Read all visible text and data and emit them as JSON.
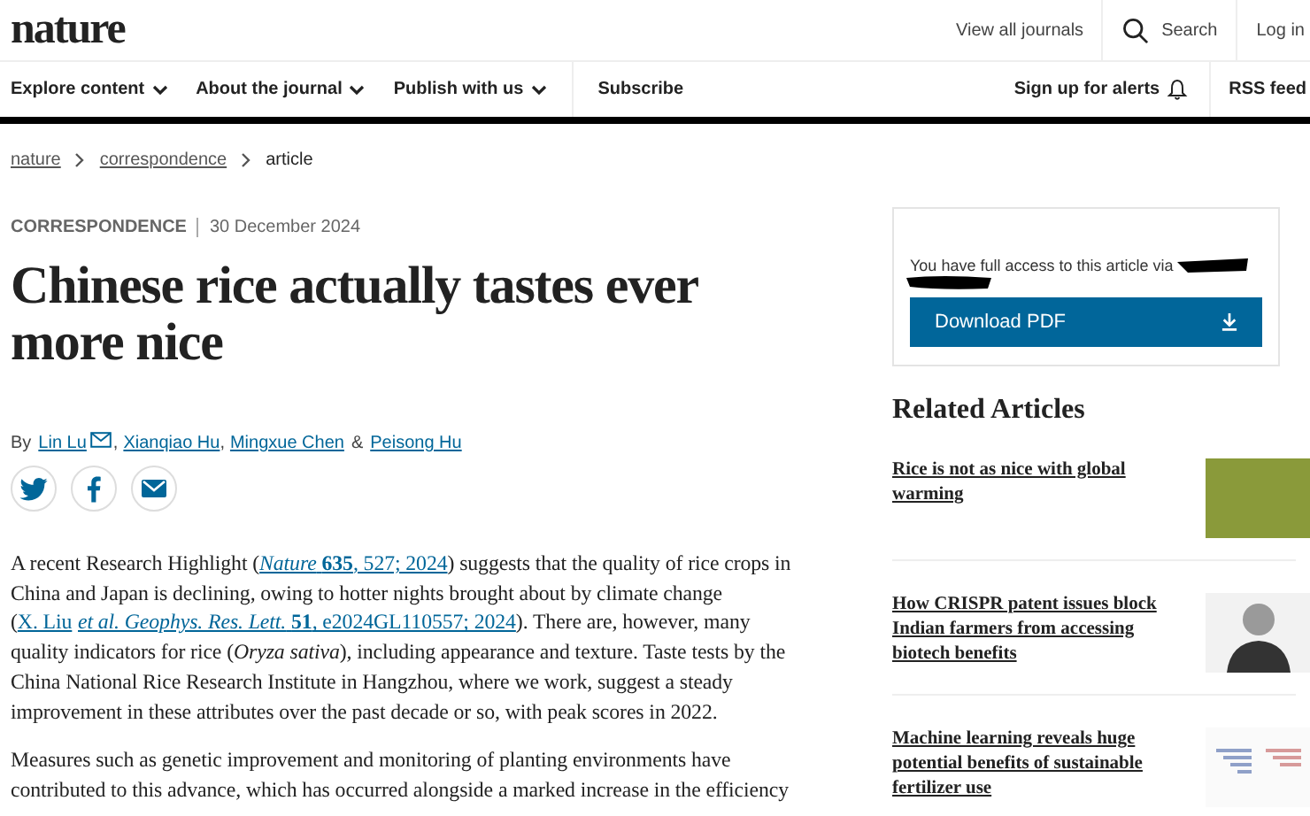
{
  "header": {
    "logo": "nature",
    "links": [
      {
        "label": "View all journals",
        "kind": "text"
      },
      {
        "label": "Search",
        "kind": "search"
      },
      {
        "label": "Log in",
        "kind": "text"
      }
    ]
  },
  "nav": {
    "left": [
      {
        "label": "Explore content",
        "kind": "dropdown"
      },
      {
        "label": "About the journal",
        "kind": "dropdown"
      },
      {
        "label": "Publish with us",
        "kind": "dropdown"
      },
      {
        "label": "Subscribe",
        "kind": "plain"
      }
    ],
    "right": [
      {
        "label": "Sign up for alerts",
        "kind": "bell"
      },
      {
        "label": "RSS feed",
        "kind": "plain"
      }
    ]
  },
  "breadcrumb": [
    {
      "label": "nature",
      "link": true
    },
    {
      "label": "correspondence",
      "link": true
    },
    {
      "label": "article",
      "link": false
    }
  ],
  "article": {
    "type": "CORRESPONDENCE",
    "date": "30 December 2024",
    "title": "Chinese rice actually tastes ever more nice",
    "by": "By",
    "authors": [
      {
        "name": "Lin Lu",
        "email": true,
        "sep": ","
      },
      {
        "name": "Xianqiao Hu",
        "email": false,
        "sep": ","
      },
      {
        "name": "Mingxue Chen",
        "email": false,
        "sep": "&"
      },
      {
        "name": "Peisong Hu",
        "email": false
      }
    ],
    "share": [
      {
        "kind": "twitter"
      },
      {
        "kind": "facebook"
      },
      {
        "kind": "email"
      }
    ],
    "paragraphs": [
      [
        {
          "kind": "text",
          "text": "A recent Research Highlight ("
        },
        {
          "kind": "link",
          "text": "*Nature* **635**, 527; 2024"
        },
        {
          "kind": "text",
          "text": ") suggests that the quality of rice crops in China and Japan is declining, owing to hotter nights brought about by climate change ("
        },
        {
          "kind": "link",
          "text": "X. Liu"
        },
        {
          "kind": "link",
          "text": "*et al. Geophys. Res. Lett.* **51**, e2024GL110557; 2024"
        },
        {
          "kind": "text",
          "text": "). There are, however, many quality indicators for rice (*Oryza sativa*), including appearance and texture. Taste tests by the China National Rice Research Institute in Hangzhou, where we work, suggest a steady improvement in these attributes over the past decade or so, with peak scores in 2022."
        }
      ],
      [
        {
          "kind": "text",
          "text": "Measures such as genetic improvement and monitoring of planting environments have contributed to this advance, which has occurred alongside a marked increase in the efficiency"
        }
      ]
    ]
  },
  "access": {
    "text": "You have full access to this article via",
    "redacted": true,
    "button": "Download PDF"
  },
  "related": {
    "heading": "Related Articles",
    "items": [
      {
        "title": "Rice is not as nice with global warming",
        "kind": "photo"
      },
      {
        "title": "How CRISPR patent issues block Indian farmers from accessing biotech benefits",
        "kind": "portrait"
      },
      {
        "title": "Machine learning reveals huge potential benefits of sustainable fertilizer use",
        "kind": "chart"
      }
    ]
  }
}
